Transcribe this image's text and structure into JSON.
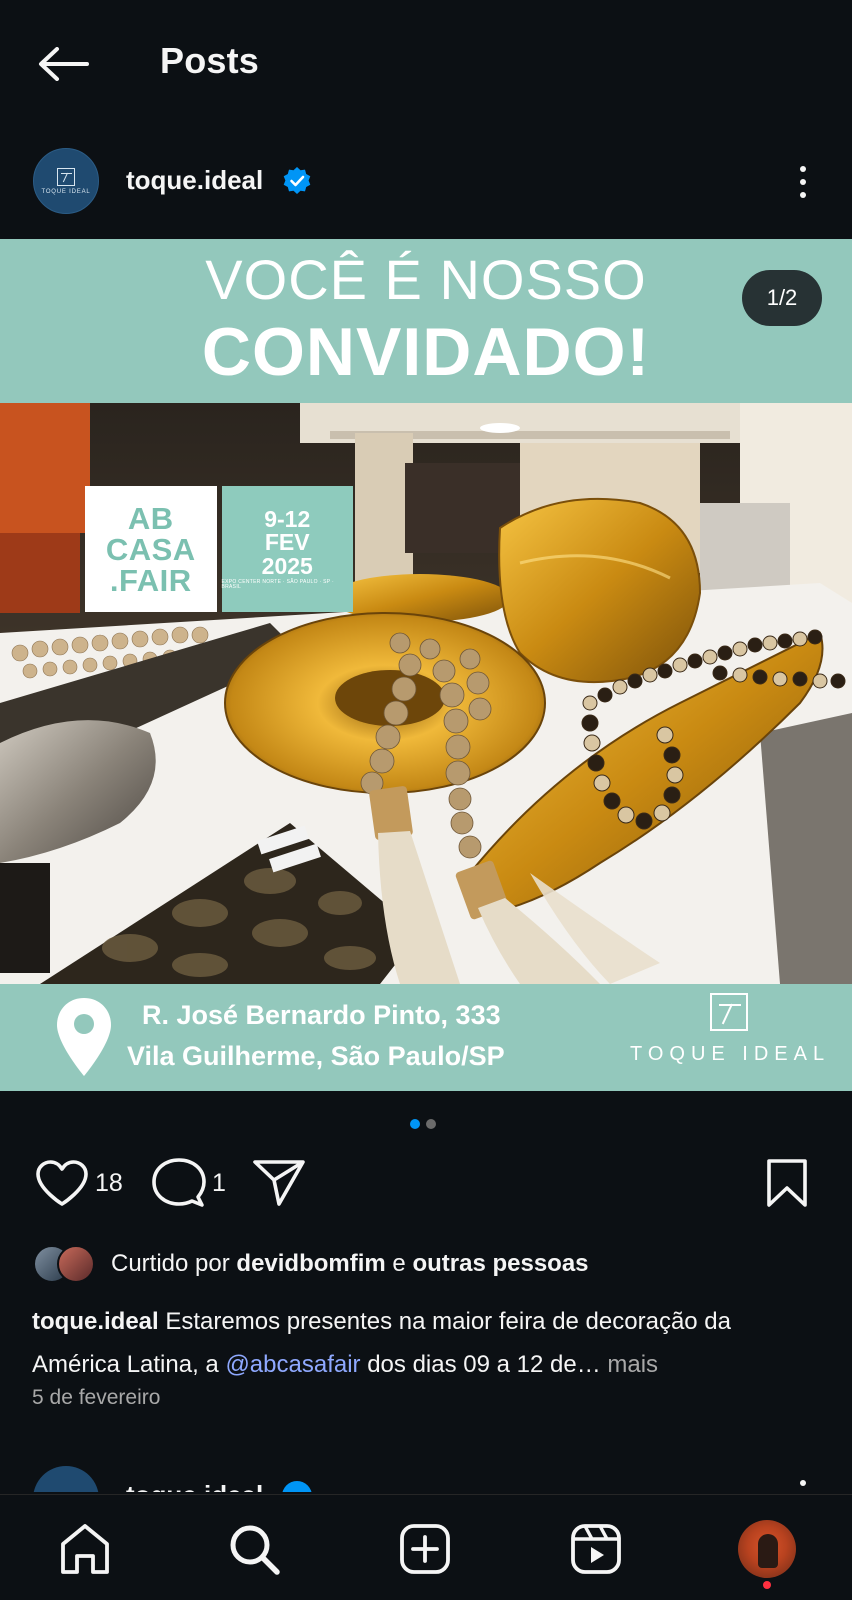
{
  "header": {
    "title": "Posts"
  },
  "post": {
    "username": "toque.ideal",
    "avatar_text": "TOQUE IDEAL",
    "image": {
      "banner_line1": "VOCÊ É NOSSO",
      "banner_line2": "CONVIDADO!",
      "counter": "1/2",
      "fair_logo": {
        "line1": "AB",
        "line2": "CASA",
        "line3": ".FAIR",
        "dates": "9-12",
        "month": "FEV",
        "year": "2025",
        "venue": "EXPO CENTER NORTE · SÃO PAULO · SP · BRASIL"
      },
      "address_line1": "R. José Bernardo Pinto, 333",
      "address_line2": "Vila Guilherme, São Paulo/SP",
      "brand_name": "TOQUE IDEAL"
    },
    "carousel": {
      "total": 2,
      "active_index": 0
    },
    "likes_count": "18",
    "comments_count": "1",
    "liked_by": {
      "prefix": "Curtido por",
      "user": "devidbomfim",
      "joiner": "e",
      "others": "outras pessoas"
    },
    "caption": {
      "user": "toque.ideal",
      "text_before": "Estaremos presentes na maior feira de decoração da América Latina, a",
      "mention": "@abcasafair",
      "text_after": "dos dias 09 a 12 de…",
      "more": "mais"
    },
    "date": "5 de fevereiro"
  },
  "next_post": {
    "username": "toque.ideal"
  },
  "colors": {
    "background": "#0c1014",
    "accent": "#0095f6",
    "mint": "#93c8bc",
    "mention": "#8fa9ff",
    "notification": "#ff3040"
  },
  "icons": {
    "back": "arrow-left-icon",
    "verified": "verified-badge-icon",
    "more": "more-vertical-icon",
    "like": "heart-icon",
    "comment": "comment-bubble-icon",
    "share": "paper-plane-icon",
    "save": "bookmark-icon",
    "nav": [
      "home-icon",
      "search-icon",
      "create-icon",
      "reels-icon",
      "profile-avatar"
    ]
  }
}
